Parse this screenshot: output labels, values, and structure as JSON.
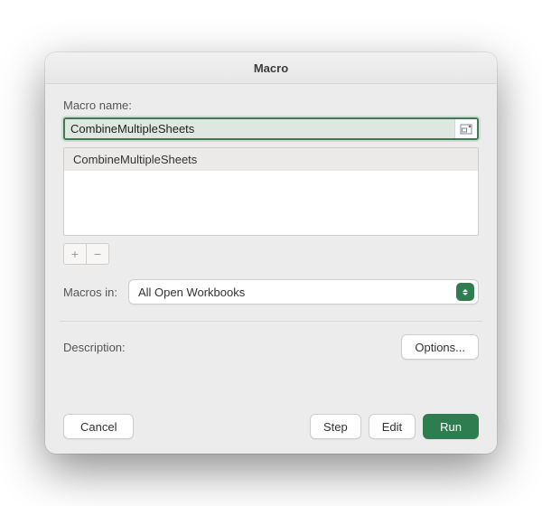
{
  "window": {
    "title": "Macro"
  },
  "labels": {
    "macro_name": "Macro name:",
    "macros_in": "Macros in:",
    "description": "Description:"
  },
  "macro_name": {
    "value": "CombineMultipleSheets"
  },
  "macro_list": {
    "items": [
      "CombineMultipleSheets"
    ]
  },
  "macros_in": {
    "selected": "All Open Workbooks"
  },
  "buttons": {
    "options": "Options...",
    "cancel": "Cancel",
    "step": "Step",
    "edit": "Edit",
    "run": "Run",
    "add": "+",
    "remove": "−"
  }
}
